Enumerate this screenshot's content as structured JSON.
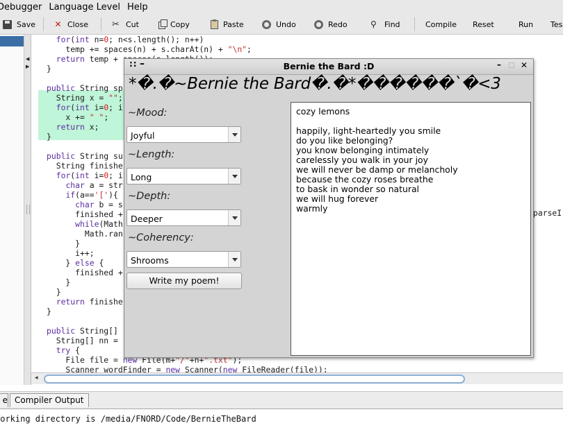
{
  "menubar": {
    "items": [
      "Debugger",
      "Language Level",
      "Help"
    ]
  },
  "toolbar": {
    "save": "Save",
    "close": "Close",
    "cut": "Cut",
    "copy": "Copy",
    "paste": "Paste",
    "undo": "Undo",
    "redo": "Redo",
    "find": "Find",
    "compile": "Compile",
    "reset": "Reset",
    "run": "Run",
    "test": "Tes"
  },
  "editor": {
    "lines": [
      "  for(int n=0; n<s.length(); n++)",
      "    temp += spaces(n) + s.charAt(n) + \"\\n\";",
      "  return temp + spaces(s.length());",
      "}",
      "",
      "public String sp",
      "  String x = \"\";",
      "  for(int i=0; i",
      "    x += \" \";",
      "  return x;",
      "}",
      "",
      "public String su",
      "  String finishe",
      "  for(int i=0; i",
      "    char a = str",
      "    if(a=='['){",
      "      char b = s",
      "      finished +",
      "      while(Math",
      "        Math.ran",
      "      }",
      "      i++;",
      "    } else {",
      "      finished +",
      "    }",
      "  }",
      "  return finishe",
      "}",
      "",
      "public String[]",
      "  String[] nn =",
      "  try {",
      "    File file = new File(m+\"/\"+n+\".txt\");",
      "    Scanner wordFinder = new Scanner(new FileReader(file));"
    ],
    "right_fragment": "parseI"
  },
  "bottom": {
    "tab_compiler": "Compiler Output",
    "output_text": "Working directory is /media/FNORD/Code/BernieTheBard"
  },
  "dialog": {
    "title": "Bernie the Bard :D",
    "heading": "*�.�~Bernie the Bard�.�*������`�<3",
    "mood_label": "~Mood:",
    "mood_value": "Joyful",
    "length_label": "~Length:",
    "length_value": "Long",
    "depth_label": "~Depth:",
    "depth_value": "Deeper",
    "coherency_label": "~Coherency:",
    "coherency_value": "Shrooms",
    "button_label": "Write my poem!",
    "poem_lines": [
      "cozy lemons",
      "",
      "happily, light-heartedly you smile",
      "do you like belonging?",
      "you know belonging intimately",
      "carelessly you walk in your joy",
      "we will never be damp or melancholy",
      "because the cozy roses breathe",
      "to bask in wonder so natural",
      "we will hug forever",
      "warmly"
    ]
  },
  "colors": {
    "keyword": "#5a2ca0",
    "number": "#d81818",
    "string": "#c03030",
    "highlight": "#bff5d8",
    "selection": "#3a6ea5"
  }
}
